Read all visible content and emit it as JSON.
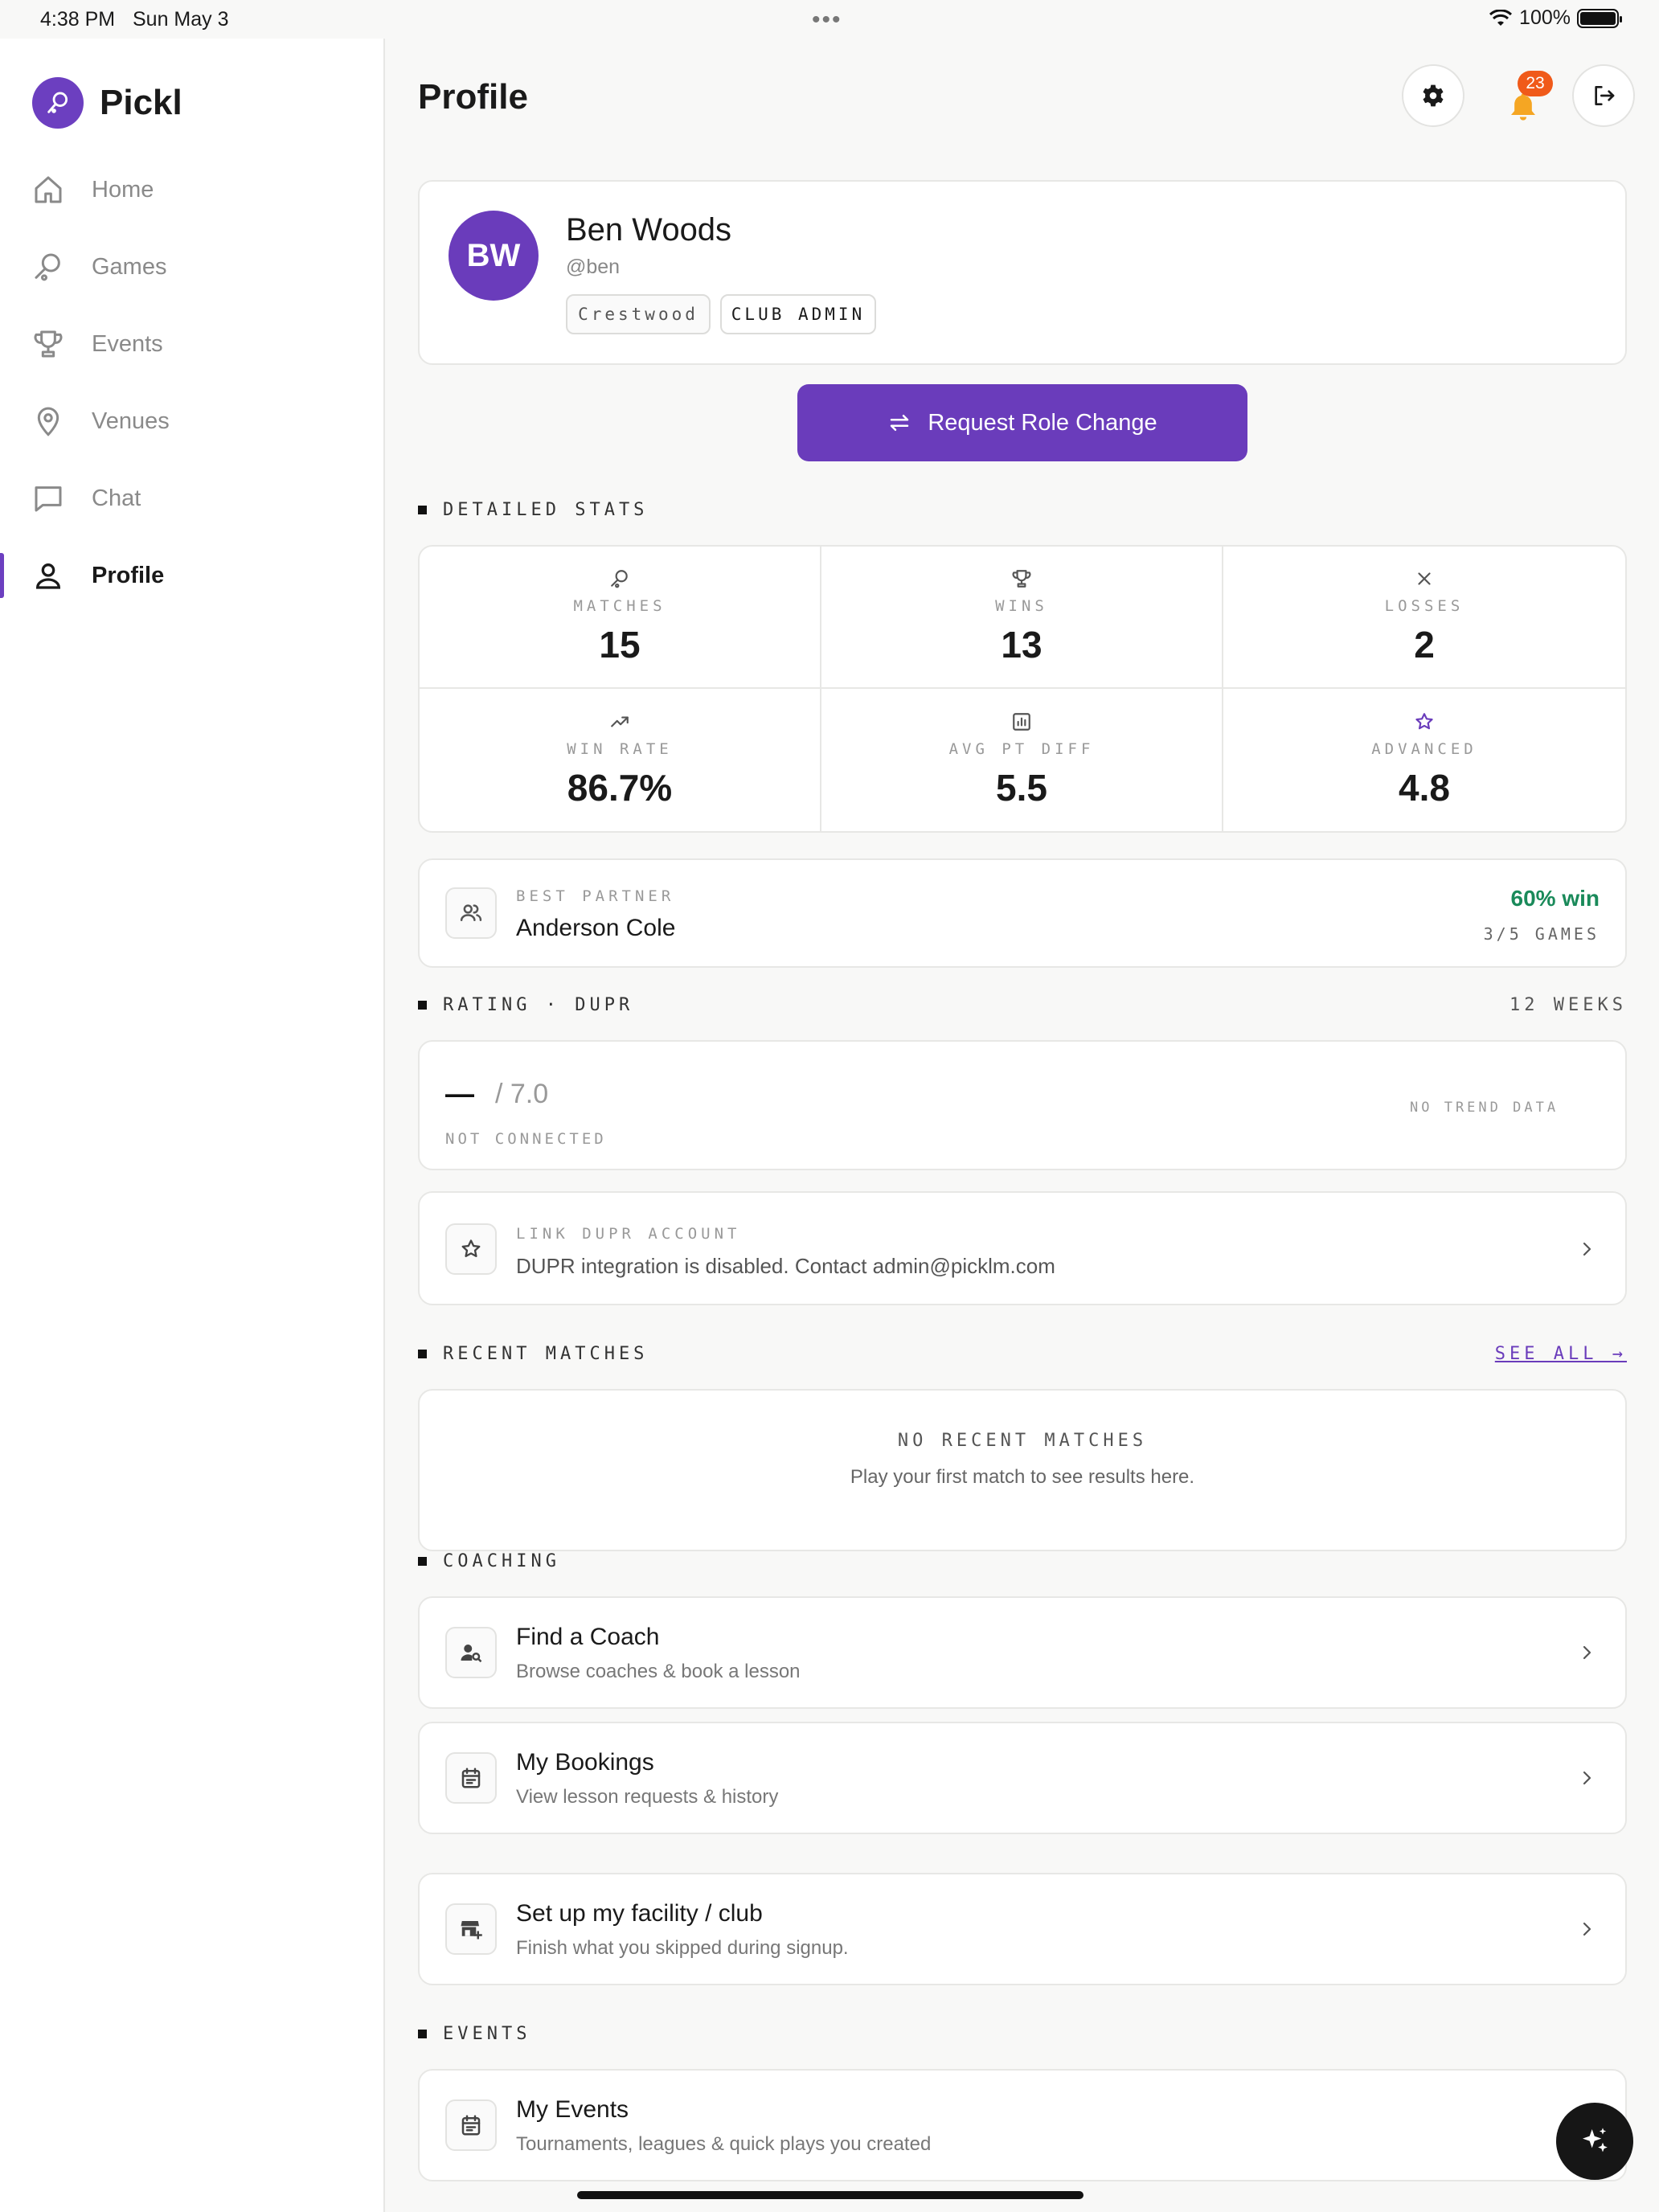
{
  "status_bar": {
    "time": "4:38 PM",
    "date": "Sun May 3",
    "battery": "100%"
  },
  "app": {
    "name": "Pickl",
    "accent": "#6a3cbb"
  },
  "sidebar": {
    "items": [
      {
        "label": "Home",
        "icon": "home-icon"
      },
      {
        "label": "Games",
        "icon": "paddle-icon"
      },
      {
        "label": "Events",
        "icon": "trophy-icon"
      },
      {
        "label": "Venues",
        "icon": "map-pin-icon"
      },
      {
        "label": "Chat",
        "icon": "chat-icon"
      },
      {
        "label": "Profile",
        "icon": "user-icon",
        "active": true
      }
    ]
  },
  "header": {
    "title": "Profile",
    "notifications_count": "23"
  },
  "profile": {
    "initials": "BW",
    "name": "Ben Woods",
    "handle": "@ben",
    "tags": [
      "Crestwood",
      "CLUB ADMIN"
    ],
    "request_button": "Request Role Change"
  },
  "detailed_stats": {
    "heading": "DETAILED STATS",
    "items": [
      {
        "label": "MATCHES",
        "value": "15",
        "icon": "paddle-icon"
      },
      {
        "label": "WINS",
        "value": "13",
        "icon": "trophy-icon"
      },
      {
        "label": "LOSSES",
        "value": "2",
        "icon": "x-icon"
      },
      {
        "label": "WIN RATE",
        "value": "86.7%",
        "icon": "trend-up-icon"
      },
      {
        "label": "AVG PT DIFF",
        "value": "5.5",
        "icon": "bar-chart-icon"
      },
      {
        "label": "ADVANCED",
        "value": "4.8",
        "icon": "star-icon"
      }
    ]
  },
  "best_partner": {
    "label": "BEST PARTNER",
    "name": "Anderson Cole",
    "win_pct": "60% win",
    "games": "3/5 GAMES",
    "win_color": "#1a8a5a"
  },
  "rating": {
    "heading": "RATING · DUPR",
    "period": "12 WEEKS",
    "value": "—",
    "max": "/ 7.0",
    "status": "NOT CONNECTED",
    "trend": "NO TREND DATA"
  },
  "link_dupr": {
    "label": "LINK DUPR ACCOUNT",
    "text": "DUPR integration is disabled. Contact admin@picklm.com"
  },
  "recent_matches": {
    "heading": "RECENT MATCHES",
    "see_all": "SEE ALL →",
    "empty_title": "NO RECENT MATCHES",
    "empty_sub": "Play your first match to see results here."
  },
  "coaching": {
    "heading": "COACHING",
    "items": [
      {
        "title": "Find a Coach",
        "sub": "Browse coaches & book a lesson"
      },
      {
        "title": "My Bookings",
        "sub": "View lesson requests & history"
      }
    ]
  },
  "facility": {
    "title": "Set up my facility / club",
    "sub": "Finish what you skipped during signup."
  },
  "events": {
    "heading": "EVENTS",
    "items": [
      {
        "title": "My Events",
        "sub": "Tournaments, leagues & quick plays you created"
      }
    ]
  }
}
